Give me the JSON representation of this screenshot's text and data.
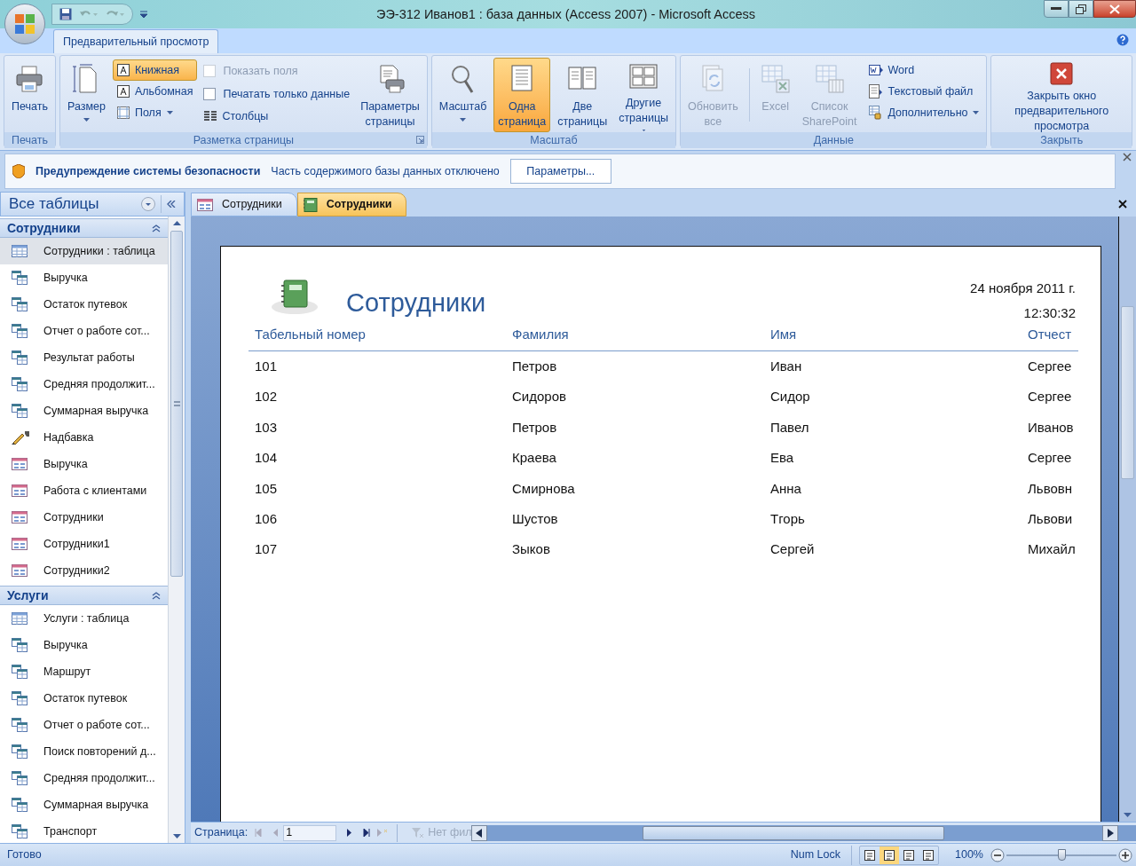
{
  "window": {
    "title": "ЭЭ-312 Иванов1 : база данных (Access 2007) - Microsoft Access"
  },
  "ribbon": {
    "tabs": [
      {
        "label": "Предварительный просмотр",
        "selected": true
      }
    ],
    "groups": [
      {
        "title": "Печать",
        "items": [
          {
            "kind": "big",
            "label": "Печать",
            "disabled": false,
            "dropdown": false
          }
        ]
      },
      {
        "title": "Разметка страницы",
        "launcher": true,
        "items": [
          {
            "kind": "big",
            "label": "Размер",
            "disabled": false,
            "dropdown": true
          },
          {
            "kind": "small",
            "label": "Книжная",
            "disabled": false,
            "dropdown": false,
            "selected": true
          },
          {
            "kind": "small",
            "label": "Альбомная",
            "disabled": false,
            "dropdown": false,
            "selected": false
          },
          {
            "kind": "small",
            "label": "Поля",
            "disabled": false,
            "dropdown": true
          },
          {
            "kind": "check",
            "label": "Показать поля",
            "disabled": true,
            "checked": false
          },
          {
            "kind": "check",
            "label": "Печатать только данные",
            "disabled": false,
            "checked": false
          },
          {
            "kind": "small",
            "label": "Столбцы",
            "disabled": false,
            "dropdown": false
          },
          {
            "kind": "big",
            "label": "Параметры\nстраницы",
            "disabled": false,
            "dropdown": false
          }
        ]
      },
      {
        "title": "Масштаб",
        "items": [
          {
            "kind": "big",
            "label": "Масштаб",
            "disabled": false,
            "dropdown": true
          },
          {
            "kind": "big",
            "label": "Одна\nстраница",
            "disabled": false,
            "dropdown": false,
            "selected": true
          },
          {
            "kind": "big",
            "label": "Две\nстраницы",
            "disabled": false,
            "dropdown": false,
            "selected": false
          },
          {
            "kind": "big",
            "label": "Другие\nстраницы",
            "disabled": false,
            "dropdown": true,
            "selected": false
          }
        ]
      },
      {
        "title": "Данные",
        "items": [
          {
            "kind": "big",
            "label": "Обновить\nвсе",
            "disabled": true,
            "dropdown": false
          },
          {
            "kind": "separator"
          },
          {
            "kind": "big",
            "label": "Excel",
            "disabled": true,
            "dropdown": false
          },
          {
            "kind": "big",
            "label": "Список\nSharePoint",
            "disabled": true,
            "dropdown": false
          },
          {
            "kind": "small",
            "label": "Word",
            "disabled": false,
            "dropdown": false
          },
          {
            "kind": "small",
            "label": "Текстовый файл",
            "disabled": false,
            "dropdown": false
          },
          {
            "kind": "small",
            "label": "Дополнительно",
            "disabled": false,
            "dropdown": true
          }
        ]
      },
      {
        "title": "Закрыть",
        "items": [
          {
            "kind": "big",
            "label": "Закрыть окно\nпредварительного просмотра",
            "disabled": false,
            "dropdown": false
          }
        ]
      }
    ]
  },
  "security_bar": {
    "title": "Предупреждение системы безопасности",
    "message": "Часть содержимого базы данных отключено",
    "button": "Параметры..."
  },
  "navigation": {
    "header": "Все таблицы",
    "sections": [
      {
        "title": "Сотрудники",
        "expanded": true,
        "items": [
          {
            "label": "Сотрудники : таблица",
            "kind": "table",
            "selected": true
          },
          {
            "label": "Выручка",
            "kind": "query",
            "selected": false
          },
          {
            "label": "Остаток путевок",
            "kind": "query",
            "selected": false
          },
          {
            "label": "Отчет о работе сот...",
            "kind": "query",
            "selected": false
          },
          {
            "label": "Результат работы",
            "kind": "query",
            "selected": false
          },
          {
            "label": "Средняя продолжит...",
            "kind": "query",
            "selected": false
          },
          {
            "label": "Суммарная выручка",
            "kind": "query",
            "selected": false
          },
          {
            "label": "Надбавка",
            "kind": "update",
            "selected": false
          },
          {
            "label": "Выручка",
            "kind": "form",
            "selected": false
          },
          {
            "label": "Работа с клиентами",
            "kind": "form",
            "selected": false
          },
          {
            "label": "Сотрудники",
            "kind": "form",
            "selected": false
          },
          {
            "label": "Сотрудники1",
            "kind": "form",
            "selected": false
          },
          {
            "label": "Сотрудники2",
            "kind": "form",
            "selected": false
          }
        ]
      },
      {
        "title": "Услуги",
        "expanded": true,
        "items": [
          {
            "label": "Услуги : таблица",
            "kind": "table",
            "selected": false
          },
          {
            "label": "Выручка",
            "kind": "query",
            "selected": false
          },
          {
            "label": "Маршрут",
            "kind": "query",
            "selected": false
          },
          {
            "label": "Остаток путевок",
            "kind": "query",
            "selected": false
          },
          {
            "label": "Отчет о работе сот...",
            "kind": "query",
            "selected": false
          },
          {
            "label": "Поиск повторений д...",
            "kind": "query",
            "selected": false
          },
          {
            "label": "Средняя продолжит...",
            "kind": "query",
            "selected": false
          },
          {
            "label": "Суммарная выручка",
            "kind": "query",
            "selected": false
          },
          {
            "label": "Транспорт",
            "kind": "query",
            "selected": false
          }
        ]
      }
    ]
  },
  "document_tabs": [
    {
      "label": "Сотрудники",
      "kind": "form",
      "selected": false
    },
    {
      "label": "Сотрудники",
      "kind": "report",
      "selected": true
    }
  ],
  "report": {
    "title": "Сотрудники",
    "date": "24 ноября 2011 г.",
    "time": "12:30:32",
    "columns": [
      "Табельный номер",
      "Фамилия",
      "Имя",
      "Отчест"
    ],
    "rows": [
      [
        "101",
        "Петров",
        "Иван",
        "Сергее"
      ],
      [
        "102",
        "Сидоров",
        "Сидор",
        "Сергее"
      ],
      [
        "103",
        "Петров",
        "Павел",
        "Иванов"
      ],
      [
        "104",
        "Краева",
        "Ева",
        "Сергее"
      ],
      [
        "105",
        "Смирнова",
        "Анна",
        "Львовн"
      ],
      [
        "106",
        "Шустов",
        "Тгорь",
        "Львови"
      ],
      [
        "107",
        "Зыков",
        "Сергей",
        "Михайл"
      ]
    ]
  },
  "record_navigator": {
    "label": "Страница:",
    "value": "1",
    "filter": "Нет фил"
  },
  "status_bar": {
    "text": "Готово",
    "num_lock": "Num Lock",
    "views": [
      {
        "selected": false
      },
      {
        "selected": true
      },
      {
        "selected": false
      },
      {
        "selected": false
      }
    ],
    "zoom": "100%",
    "level": 0.5
  }
}
